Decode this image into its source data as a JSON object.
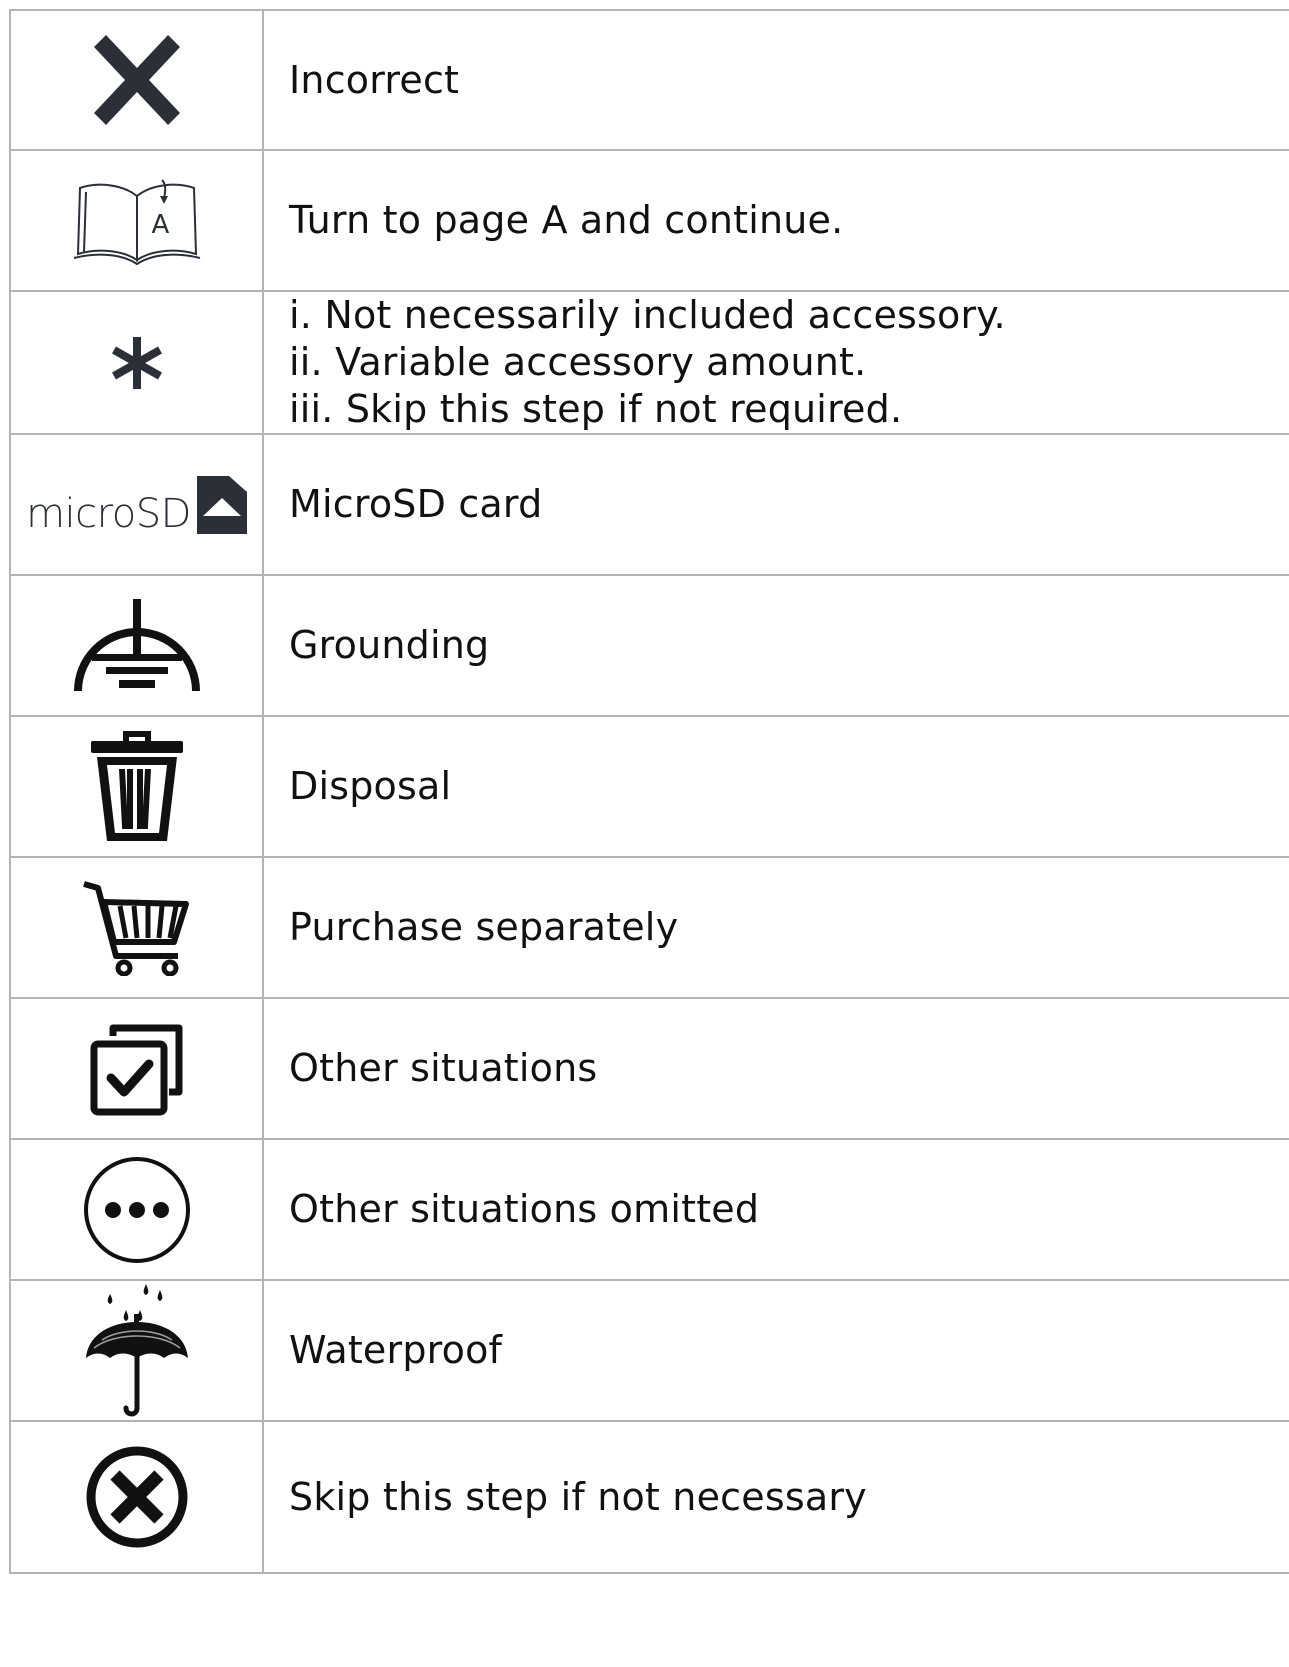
{
  "rows": [
    {
      "icon": "x-mark-icon",
      "text": "Incorrect"
    },
    {
      "icon": "open-book-page-icon",
      "page_letter": "A",
      "text": "Turn to page A and continue."
    },
    {
      "icon": "asterisk-icon",
      "lines": [
        "i. Not necessarily included accessory.",
        "ii. Variable accessory amount.",
        "iii. Skip this step if not required."
      ]
    },
    {
      "icon": "microsd-card-icon",
      "logo_text": "microSD",
      "text": "MicroSD card"
    },
    {
      "icon": "grounding-icon",
      "text": "Grounding"
    },
    {
      "icon": "trash-can-icon",
      "text": "Disposal"
    },
    {
      "icon": "shopping-cart-icon",
      "text": "Purchase separately"
    },
    {
      "icon": "stacked-checkbox-icon",
      "text": "Other situations"
    },
    {
      "icon": "ellipsis-circle-icon",
      "text": "Other situations omitted"
    },
    {
      "icon": "umbrella-rain-icon",
      "text": "Waterproof"
    },
    {
      "icon": "circle-x-icon",
      "text": "Skip this step if not necessary"
    }
  ],
  "colors": {
    "icon_dark": "#2a2f38",
    "border": "#b3b3b3",
    "text": "#111111"
  }
}
